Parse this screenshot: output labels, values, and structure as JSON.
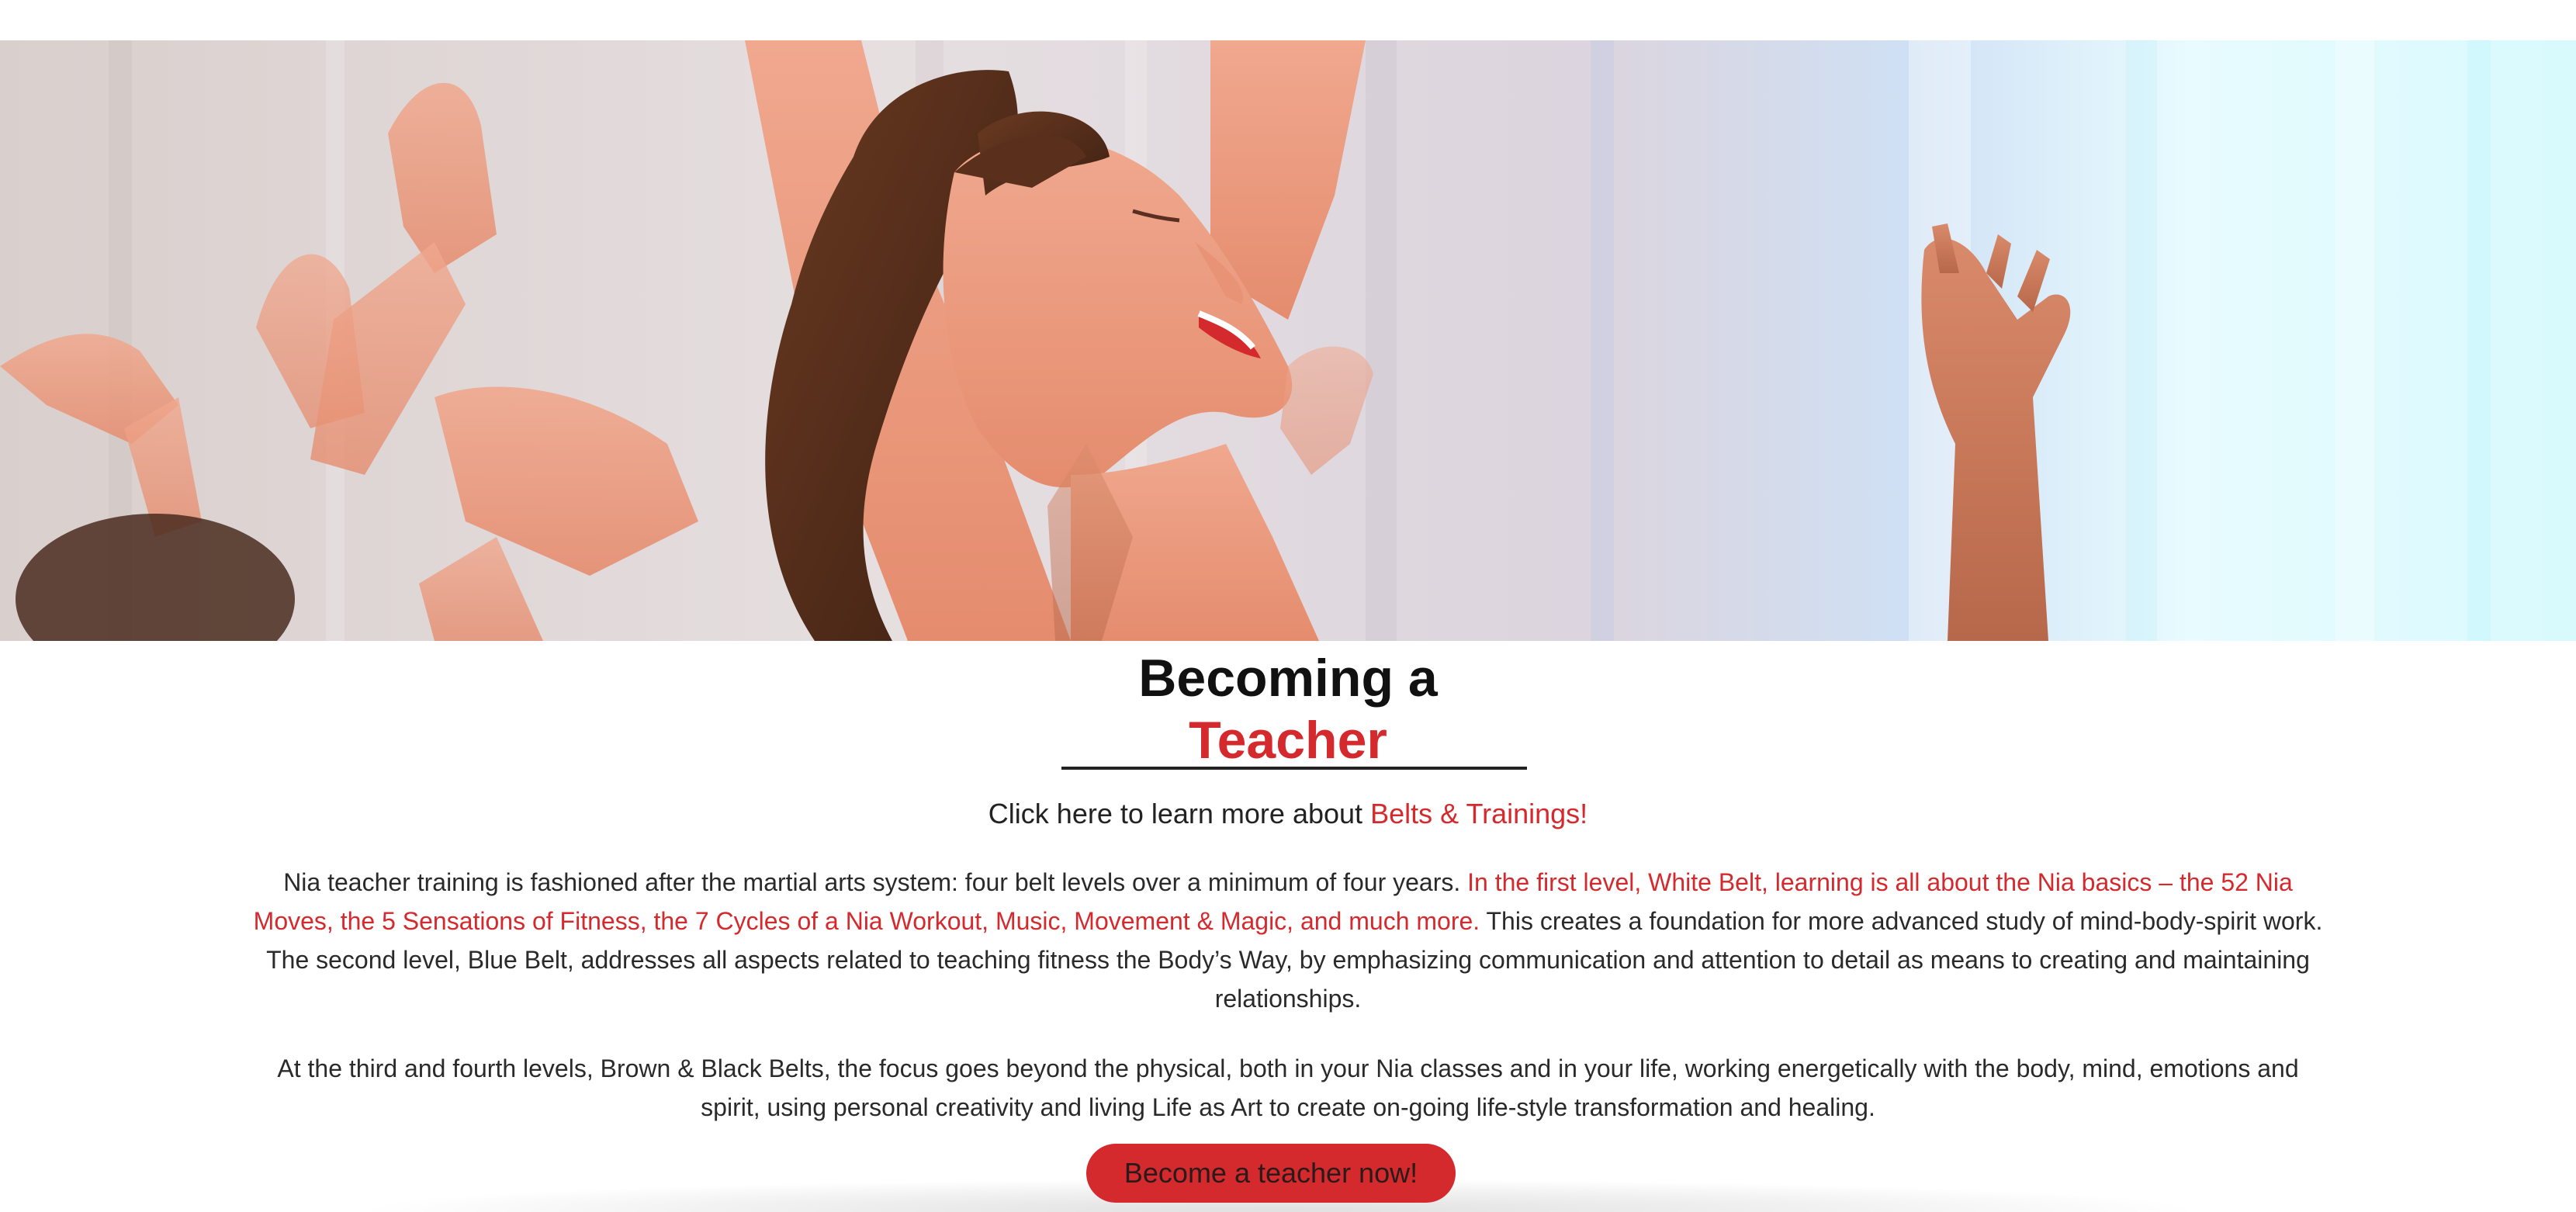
{
  "hero": {
    "image_name": "dancing-woman-photo"
  },
  "heading": {
    "line1": "Becoming a",
    "line2": "Teacher"
  },
  "learn_more": {
    "prefix": "Click here to learn more about",
    "link_label": "Belts & Trainings!"
  },
  "paragraphs": {
    "p1_intro": "Nia teacher training is fashioned after the martial arts system: four belt levels over a minimum of four years. ",
    "p1_highlight": "In the first level, White Belt, learning is all about the Nia basics – the 52 Nia Moves, the 5 Sensations of Fitness, the 7 Cycles of a Nia Workout, Music, Movement & Magic, and much more.",
    "p1_rest": " This creates a foundation for more advanced study of mind-body-spirit work. The second level, Blue Belt, addresses all aspects related to teaching fitness the Body’s Way, by emphasizing communication and attention to detail as means to creating and maintaining relationships.",
    "p2": "At the third and fourth levels, Brown & Black Belts, the focus goes beyond the physical, both in your Nia classes and in your life, working energetically with the body, mind, emotions and spirit, using personal creativity and living Life as Art to create on-going life-style transformation and healing."
  },
  "cta": {
    "label": "Become a teacher now!"
  },
  "colors": {
    "accent": "#d42a2e",
    "text": "#2a2a2a",
    "heading": "#111111"
  }
}
